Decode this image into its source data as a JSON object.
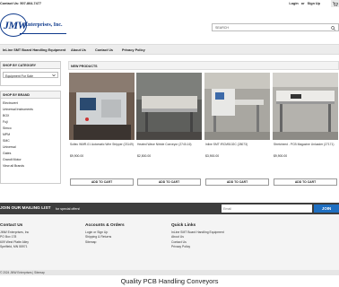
{
  "topbar": {
    "contact": "Contact Us: 507-864-7477",
    "login": "Login",
    "or": "or",
    "signup": "Sign Up"
  },
  "logo": {
    "mark": "JMW",
    "name": "Enterprises, Inc."
  },
  "search": {
    "placeholder": "SEARCH"
  },
  "nav": [
    "InLine SMT Board Handling Equipment",
    "About Us",
    "Contact Us",
    "Privacy Policy"
  ],
  "sidebar": {
    "category_heading": "SHOP BY CATEGORY",
    "category_selected": "Equipment For Sale",
    "brand_heading": "SHOP BY BRAND",
    "brands": [
      "Electrovert",
      "Universal Instruments",
      "BOX",
      "Fuji",
      "Simco",
      "MPM",
      "SMC",
      "Universal",
      "Gates",
      "Grandt Motor",
      "View all Brands"
    ]
  },
  "new_products_heading": "NEW PRODUCTS",
  "products": [
    {
      "name": "Soltec WMR-01 Automatic Wire Stripper (23149)",
      "price": "$9,900.00",
      "button": "ADD TO CART"
    },
    {
      "name": "Heated Wave Nitride Conveyor (2740-16)",
      "price": "$2,500.00",
      "button": "ADD TO CART"
    },
    {
      "name": "Inline SMT IRCM5102C (28073)",
      "price": "$3,900.00",
      "button": "ADD TO CART"
    },
    {
      "name": "Stretcheed - PCB Magazine Unloader (27171)",
      "price": "$9,900.00",
      "button": "ADD TO CART"
    }
  ],
  "mailing": {
    "title": "JOIN OUR MAILING LIST",
    "subtitle": "for special offers!",
    "email_placeholder": "Email",
    "join": "JOIN"
  },
  "footer": {
    "contact": {
      "heading": "Contact Us",
      "lines": [
        "JMW Enterprises, Inc",
        "PO Box 178",
        "609 West Platte Alley",
        "Spelfield, MN 55971"
      ]
    },
    "accounts": {
      "heading": "Accounts & Orders",
      "links": [
        "Login or Sign Up",
        "Shipping & Returns",
        "Sitemap"
      ]
    },
    "quick": {
      "heading": "Quick Links",
      "links": [
        "InLine SMT Board Handling Equipment",
        "About Us",
        "Contact Us",
        "Privacy Policy"
      ]
    },
    "copyright": "© 2024 JMW Enterprises | Sitemap"
  },
  "tagline": "Quality PCB Handling Conveyors",
  "colors": {
    "brand_blue": "#0f3a8c",
    "join_blue": "#1f6fc1",
    "mail_bar": "#3d3d3d"
  },
  "icons": {
    "cart": "cart-icon",
    "search": "search-icon",
    "dropdown": "chevron-down-icon"
  }
}
